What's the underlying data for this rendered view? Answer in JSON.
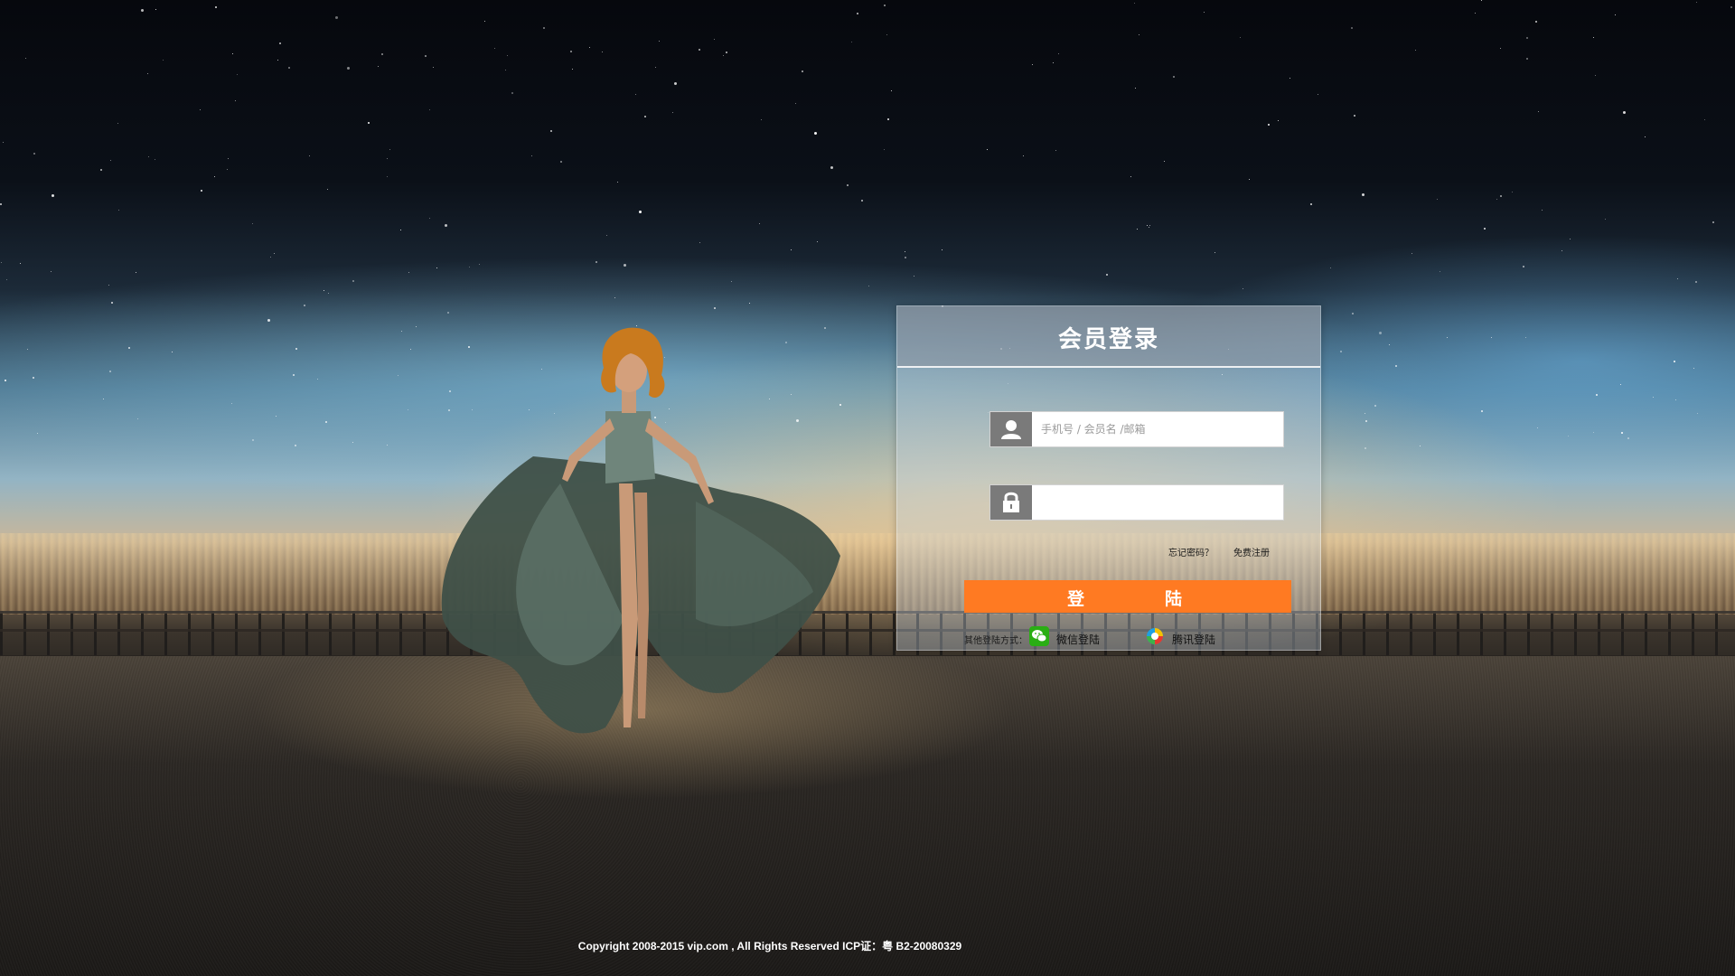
{
  "login": {
    "title": "会员登录",
    "username_placeholder": "手机号 / 会员名 /邮箱",
    "password_value": "",
    "forgot_link": "忘记密码？",
    "register_link": "免费注册",
    "login_button_char1": "登",
    "login_button_char2": "陆",
    "other_methods_label": "其他登陆方式：",
    "wechat_label": "微信登陆",
    "tencent_label": "腾讯登陆"
  },
  "icons": {
    "user": "user-icon",
    "lock": "lock-icon",
    "wechat": "wechat-icon",
    "tencent": "tencent-icon"
  },
  "colors": {
    "accent": "#ff7a22",
    "icon_bg": "#7a7a7a",
    "wechat_green": "#2aae14"
  },
  "footer": {
    "copyright": "Copyright 2008-2015 vip.com , All Rights Reserved ICP证：粤 B2-20080329"
  }
}
